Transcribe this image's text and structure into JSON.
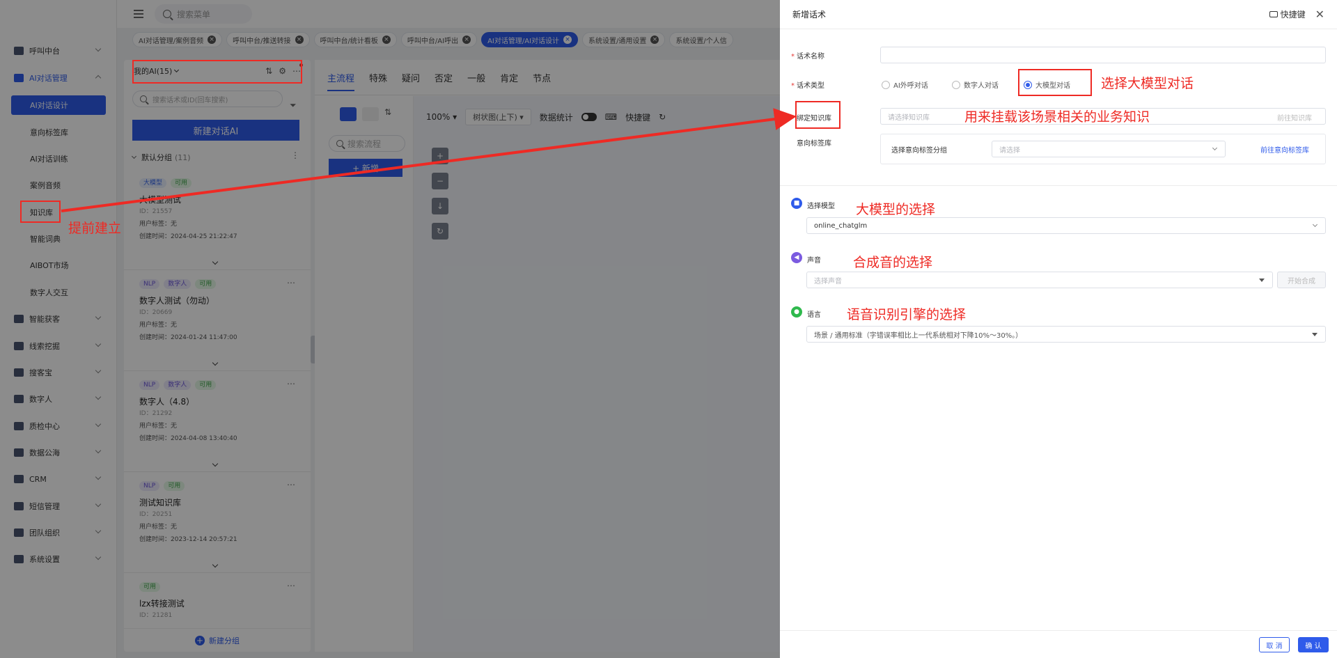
{
  "sidebar": {
    "items": [
      {
        "label": "呼叫中台",
        "expanded": false
      },
      {
        "label": "AI对话管理",
        "expanded": true,
        "children": [
          {
            "label": "AI对话设计",
            "active": true
          },
          {
            "label": "意向标签库"
          },
          {
            "label": "AI对话训练"
          },
          {
            "label": "案例音频"
          },
          {
            "label": "知识库"
          },
          {
            "label": "智能词典"
          },
          {
            "label": "AIBOT市场"
          },
          {
            "label": "数字人交互"
          }
        ]
      },
      {
        "label": "智能获客"
      },
      {
        "label": "线索挖掘"
      },
      {
        "label": "搜客宝"
      },
      {
        "label": "数字人"
      },
      {
        "label": "质检中心"
      },
      {
        "label": "数据公海"
      },
      {
        "label": "CRM"
      },
      {
        "label": "短信管理"
      },
      {
        "label": "团队组织"
      },
      {
        "label": "系统设置"
      }
    ]
  },
  "topbar": {
    "search_placeholder": "搜索菜单"
  },
  "tabs": [
    {
      "label": "AI对话管理/案例音频",
      "active": false
    },
    {
      "label": "呼叫中台/推送转接",
      "active": false
    },
    {
      "label": "呼叫中台/统计看板",
      "active": false
    },
    {
      "label": "呼叫中台/AI呼出",
      "active": false
    },
    {
      "label": "AI对话管理/AI对话设计",
      "active": true
    },
    {
      "label": "系统设置/通用设置",
      "active": false
    },
    {
      "label": "系统设置/个人信",
      "active": false
    }
  ],
  "left_panel": {
    "title": "我的AI(15)",
    "search_placeholder": "搜索话术或ID(回车搜索)",
    "new_button": "新建对话AI",
    "group": {
      "name": "默认分组",
      "count": "(11)"
    },
    "cards": [
      {
        "tags": [
          {
            "text": "大模型",
            "color": "blue"
          },
          {
            "text": "可用",
            "color": "green"
          }
        ],
        "name": "大模型测试",
        "id": "ID：21557",
        "user_tags": "用户标签：无",
        "created": "创建时间：2024-04-25 21:22:47"
      },
      {
        "tags": [
          {
            "text": "NLP",
            "color": "purple"
          },
          {
            "text": "数字人",
            "color": "purple"
          },
          {
            "text": "可用",
            "color": "green"
          }
        ],
        "name": "数字人测试（勿动）",
        "id": "ID：20669",
        "user_tags": "用户标签：无",
        "created": "创建时间：2024-01-24 11:47:00"
      },
      {
        "tags": [
          {
            "text": "NLP",
            "color": "purple"
          },
          {
            "text": "数字人",
            "color": "purple"
          },
          {
            "text": "可用",
            "color": "green"
          }
        ],
        "name": "数字人（4.8）",
        "id": "ID：21292",
        "user_tags": "用户标签：无",
        "created": "创建时间：2024-04-08 13:40:40"
      },
      {
        "tags": [
          {
            "text": "NLP",
            "color": "purple"
          },
          {
            "text": "可用",
            "color": "green"
          }
        ],
        "name": "测试知识库",
        "id": "ID：20251",
        "user_tags": "用户标签：无",
        "created": "创建时间：2023-12-14 20:57:21"
      },
      {
        "tags": [
          {
            "text": "可用",
            "color": "green"
          }
        ],
        "name": "lzx转接测试",
        "id": "ID：21281",
        "user_tags": "",
        "created": ""
      }
    ],
    "new_group": "新建分组"
  },
  "main": {
    "tabs": [
      "主流程",
      "特殊",
      "疑问",
      "否定",
      "一般",
      "肯定",
      "节点"
    ],
    "flow_search_placeholder": "搜索流程",
    "new_flow": "+ 新增",
    "zoom": "100%",
    "layout_select": "树状图(上下)",
    "data_stats": "数据统计",
    "shortcut": "快捷键"
  },
  "drawer": {
    "title": "新增话术",
    "shortcut": "快捷键",
    "name_label": "话术名称",
    "type_label": "话术类型",
    "type_options": [
      {
        "label": "AI外呼对话",
        "selected": false
      },
      {
        "label": "数字人对话",
        "selected": false
      },
      {
        "label": "大模型对话",
        "selected": true
      }
    ],
    "kb_label": "绑定知识库",
    "kb_placeholder": "请选择知识库",
    "kb_link": "前往知识库",
    "intent_label": "意向标签库",
    "intent_group_label": "选择意向标签分组",
    "intent_placeholder": "请选择",
    "intent_link": "前往意向标签库",
    "model_label": "选择模型",
    "model_value": "online_chatglm",
    "voice_label": "声音",
    "voice_placeholder": "选择声音",
    "synth_button": "开始合成",
    "lang_label": "语言",
    "lang_value": "场景 / 通用标准（字错误率相比上一代系统相对下降10%～30%。）",
    "cancel": "取 消",
    "confirm": "确 认"
  },
  "annotations": {
    "select_llm": "选择大模型对话",
    "kb_note": "用来挂载该场景相关的业务知识",
    "model_note": "大模型的选择",
    "voice_note": "合成音的选择",
    "asr_note": "语音识别引擎的选择",
    "prebuild": "提前建立"
  },
  "colors": {
    "primary": "#2f5bea",
    "annotation": "#ee2a24"
  }
}
